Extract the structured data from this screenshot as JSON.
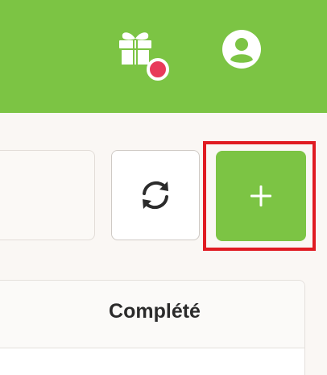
{
  "header": {
    "icons": {
      "gift": "gift-icon",
      "user": "user-circle-icon"
    },
    "notification_color": "#e83a5a",
    "bg_color": "#7cc444"
  },
  "toolbar": {
    "refresh_icon": "refresh-icon",
    "add_icon": "plus-icon"
  },
  "table": {
    "columns": [
      "Complété"
    ]
  }
}
